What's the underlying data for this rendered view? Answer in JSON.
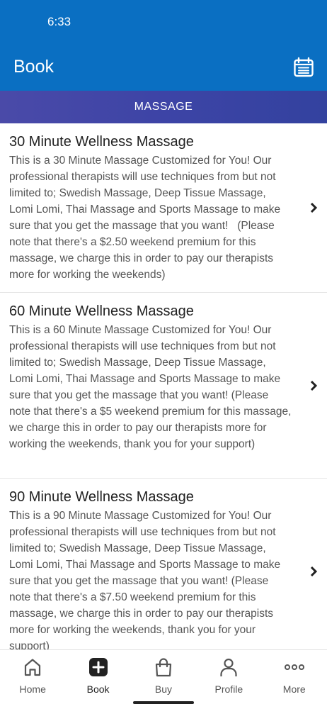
{
  "status_bar": {
    "time": "6:33"
  },
  "header": {
    "title": "Book",
    "calendar_icon": "calendar-icon"
  },
  "category": {
    "label": "MASSAGE"
  },
  "services": [
    {
      "title": "30 Minute Wellness Massage",
      "description": "This is a 30 Minute Massage Customized for You! Our professional therapists will use techniques from but not limited to; Swedish Massage, Deep Tissue Massage, Lomi Lomi, Thai Massage and Sports Massage to make sure that you get the massage that you want!   (Please note that there's a $2.50 weekend premium for this massage, we charge this in order to pay our therapists more for working the weekends)"
    },
    {
      "title": "60 Minute Wellness Massage",
      "description": "This is a 60 Minute Massage Customized for You! Our professional therapists will use techniques from but not limited to; Swedish Massage, Deep Tissue Massage, Lomi Lomi, Thai Massage and Sports Massage to make sure that you get the massage that you want! (Please note that there's a $5 weekend premium for this massage, we charge this in order to pay our therapists more for working the weekends, thank you for your support)"
    },
    {
      "title": "90 Minute Wellness Massage",
      "description": "This is a 90 Minute Massage Customized for You! Our professional therapists will use techniques from but not limited to; Swedish Massage, Deep Tissue Massage, Lomi Lomi, Thai Massage and Sports Massage to make sure that you get the massage that you want! (Please note that there's a $7.50 weekend premium for this massage, we charge this in order to pay our therapists more for working the weekends, thank you for your support)"
    }
  ],
  "bottom_nav": {
    "active": "Book",
    "items": [
      {
        "label": "Home",
        "icon": "home-icon"
      },
      {
        "label": "Book",
        "icon": "plus-box-icon"
      },
      {
        "label": "Buy",
        "icon": "shopping-bag-icon"
      },
      {
        "label": "Profile",
        "icon": "person-icon"
      },
      {
        "label": "More",
        "icon": "more-dots-icon"
      }
    ]
  },
  "colors": {
    "primary": "#0a6fc2",
    "category_bar": "#3d44a6",
    "text_dark": "#222222",
    "text_muted": "#555555"
  }
}
